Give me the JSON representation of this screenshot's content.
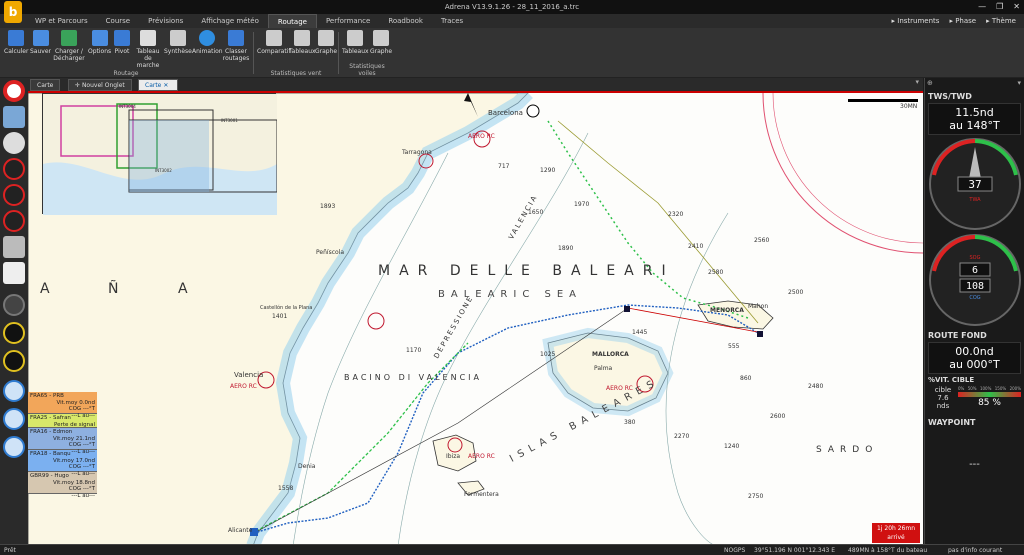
{
  "window": {
    "title": "Adrena V13.9.1.26 - 28_11_2016_a.trc",
    "logo": "b"
  },
  "menu_tabs": [
    "WP et Parcours",
    "Course",
    "Prévisions",
    "Affichage météo",
    "Routage",
    "Performance",
    "Roadbook",
    "Traces"
  ],
  "right_menu": [
    "Instruments",
    "Phase",
    "Thème"
  ],
  "ribbon": {
    "routage_buttons": [
      "Calculer",
      "Sauver",
      "Charger / Décharger",
      "Options",
      "Pivot",
      "Tableau de marche",
      "Synthèse",
      "Animation",
      "Classer routages"
    ],
    "routage_label": "Routage",
    "vent_buttons": [
      "Comparatif",
      "Tableaux",
      "Graphe"
    ],
    "vent_label": "Statistiques vent",
    "voiles_buttons": [
      "Tableaux",
      "Graphe"
    ],
    "voiles_label": "Statistiques voiles"
  },
  "doc_tabs": [
    "Carte",
    "Nouvel Onglet",
    "Carte"
  ],
  "map": {
    "sea_title_it": "MAR DELLE BALEARI",
    "sea_title_en": "BALEARIC SEA",
    "islands_title": "ISLAS BALEARES",
    "country": [
      "A",
      "Ñ",
      "A"
    ],
    "basin": "BACINO DI VALENCIA",
    "depression": "DEPRESSIONE",
    "valencia_trough": "VALENCIA",
    "sardo": "SARDO",
    "scale": "30MN",
    "cities": [
      "Barcelona",
      "Tarragona",
      "Valencia",
      "Denia",
      "Alicante",
      "Castellón de la Plana",
      "Peñíscola",
      "Mahon",
      "MENORCA",
      "MALLORCA",
      "Palma",
      "Ibiza",
      "Formentera"
    ],
    "aero": "AERO RC",
    "depths": [
      "1893",
      "717",
      "1290",
      "1650",
      "1970",
      "1890",
      "2320",
      "2560",
      "2580",
      "2500",
      "2410",
      "2480",
      "2600",
      "1445",
      "1170",
      "1025",
      "1240",
      "2270",
      "2750",
      "1558",
      "380",
      "555",
      "860",
      "1401"
    ],
    "minimap_labels": [
      "INT3004",
      "INT3001",
      "INT3002"
    ]
  },
  "boats": [
    {
      "name": "FRA65 - PRB",
      "l1": "Vit.moy 0.0nd",
      "l2": "COG ---°T",
      "l3": "---L au---",
      "color": "#f2a65a"
    },
    {
      "name": "FRA25 - Safran",
      "l1": "Perte de signal",
      "l2": "",
      "l3": "",
      "color": "#d8e86a"
    },
    {
      "name": "FRA16 - Edmon",
      "l1": "Vit.moy 21.1nd",
      "l2": "COG ---°T",
      "l3": "---L au---",
      "color": "#8eb0e0"
    },
    {
      "name": "FRA18 - Banqu",
      "l1": "Vit.moy 17.0nd",
      "l2": "COG ---°T",
      "l3": "---L au---",
      "color": "#7bb0f0"
    },
    {
      "name": "GBR99 - Hugo",
      "l1": "Vit.moy 18.8nd",
      "l2": "COG ---°T",
      "l3": "---L au---",
      "color": "#d6c7b0"
    }
  ],
  "panel": {
    "tws_head": "TWS/TWD",
    "tws_value": "11.5nd",
    "twd_value": "au 148°T",
    "gauge1_center": "37",
    "gauge1_label": "TWA",
    "gauge2_top": "6",
    "gauge2_mid": "108",
    "gauge2_top_lbl": "SOG",
    "gauge2_bot_lbl": "COG",
    "route_head": "ROUTE FOND",
    "route_speed": "00.0nd",
    "route_dir": "au 000°T",
    "vit_head": "%VIT. CIBLE",
    "cible_label": "cible",
    "cible_value": "7.6",
    "cible_unit": "nds",
    "pct_value": "85 %",
    "pct_scale": [
      "0%",
      "50%",
      "100%",
      "150%",
      "200%"
    ],
    "waypoint_head": "WAYPOINT",
    "waypoint_value": "---"
  },
  "eta": {
    "line1": "1j 20h 26mn",
    "line2": "arrivé"
  },
  "status": {
    "left": "Prêt",
    "nogps": "NOGPS",
    "pos": "39°51.196 N  001°12.343 E",
    "dist": "489MN à 158°T du bateau",
    "info": "pas d'info courant"
  },
  "colors": {
    "accent": "#0b5fa8",
    "alert": "#d01010",
    "route_blue": "#1f5fc0",
    "wind_green": "#2ec04a"
  }
}
